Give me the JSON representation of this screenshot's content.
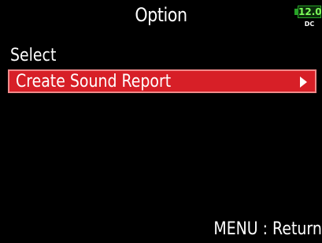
{
  "screen": {
    "title": "Option",
    "power": {
      "battery_voltage": "12.0",
      "source_label": "DC",
      "indicator_color": "#27a327"
    },
    "section_label": "Select",
    "menu": {
      "items": [
        {
          "label": "Create Sound Report",
          "selected": true,
          "icon": "chevron-right-icon"
        }
      ],
      "highlight_color": "#d71f27"
    },
    "footer_hint": "MENU : Return"
  }
}
